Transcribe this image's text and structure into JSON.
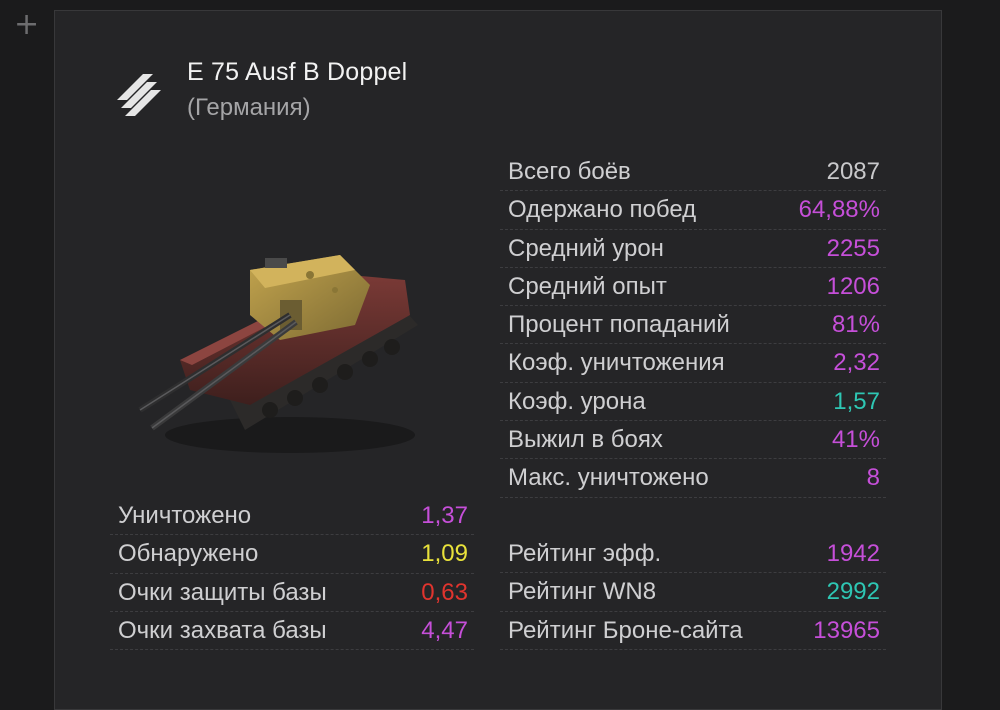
{
  "ui": {
    "add_icon": "+"
  },
  "vehicle": {
    "name": "E 75 Ausf B Doppel",
    "nation": "(Германия)",
    "tier_icon": "chevron-stripes-icon",
    "image": "tank-image"
  },
  "colors": {
    "purple": "#c64fd9",
    "teal": "#2ec6b3",
    "yellow": "#e9e23b",
    "red": "#e0342e",
    "neutral": "#c9c9cb"
  },
  "main_stats": [
    {
      "label": "Всего боёв",
      "value": "2087",
      "color": "#c9c9cb"
    },
    {
      "label": "Одержано побед",
      "value": "64,88%",
      "color": "#c64fd9"
    },
    {
      "label": "Средний урон",
      "value": "2255",
      "color": "#c64fd9"
    },
    {
      "label": "Средний опыт",
      "value": "1206",
      "color": "#c64fd9"
    },
    {
      "label": "Процент попаданий",
      "value": "81%",
      "color": "#c64fd9"
    },
    {
      "label": "Коэф. уничтожения",
      "value": "2,32",
      "color": "#c64fd9"
    },
    {
      "label": "Коэф. урона",
      "value": "1,57",
      "color": "#2ec6b3"
    },
    {
      "label": "Выжил в боях",
      "value": "41%",
      "color": "#c64fd9"
    },
    {
      "label": "Макс. уничтожено",
      "value": "8",
      "color": "#c64fd9"
    }
  ],
  "per_battle_stats": [
    {
      "label": "Уничтожено",
      "value": "1,37",
      "color": "#c64fd9"
    },
    {
      "label": "Обнаружено",
      "value": "1,09",
      "color": "#e9e23b"
    },
    {
      "label": "Очки защиты базы",
      "value": "0,63",
      "color": "#e0342e"
    },
    {
      "label": "Очки захвата базы",
      "value": "4,47",
      "color": "#c64fd9"
    }
  ],
  "ratings": [
    {
      "label": "Рейтинг эфф.",
      "value": "1942",
      "color": "#c64fd9"
    },
    {
      "label": "Рейтинг WN8",
      "value": "2992",
      "color": "#2ec6b3"
    },
    {
      "label": "Рейтинг Броне-сайта",
      "value": "13965",
      "color": "#c64fd9"
    }
  ]
}
